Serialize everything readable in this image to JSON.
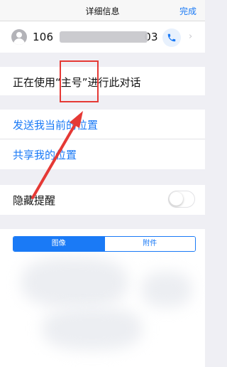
{
  "nav": {
    "title": "详细信息",
    "done_label": "完成"
  },
  "contact": {
    "number_prefix": "106",
    "number_suffix": "03",
    "avatar_icon": "person-icon",
    "call_icon": "phone-icon",
    "chevron_icon": "chevron-right-icon"
  },
  "info": {
    "text": "正在使用“主号”进行此对话"
  },
  "location": {
    "send_location_label": "发送我当前的位置",
    "share_location_label": "共享我的位置"
  },
  "alerts": {
    "hide_alerts_label": "隐藏提醒",
    "hide_alerts_on": false
  },
  "media_tabs": {
    "images_label": "图像",
    "attachments_label": "附件",
    "selected": "图像"
  },
  "colors": {
    "accent": "#1a7af6",
    "annotation": "#e53935",
    "background": "#efeff4"
  }
}
